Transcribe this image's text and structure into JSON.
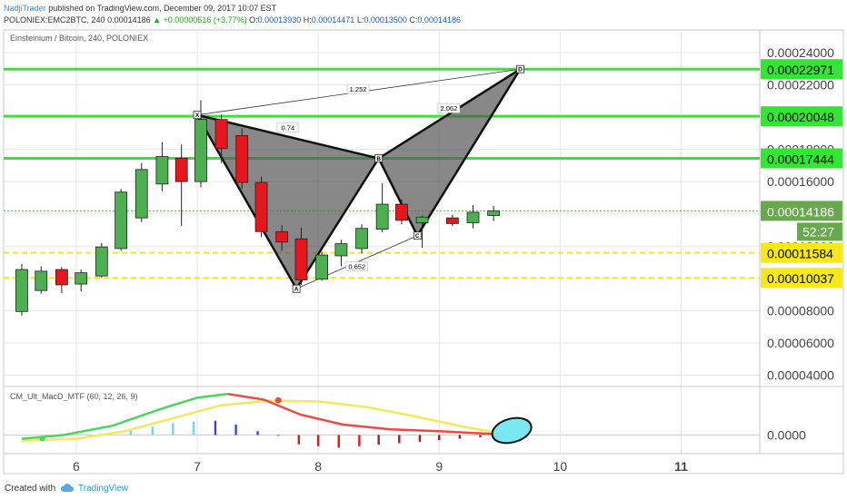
{
  "header": {
    "author": "NadjiTrader",
    "published_text": " published on TradingView.com, December 09, 2017 10:07 EST",
    "symbol_line_prefix": "POLONIEX:EMC2BTC, 240",
    "price": "0.00014186",
    "change": "▲ +0.00000516 (+3.77%)",
    "o_label": "O:",
    "o_value": "0.00013930",
    "h_label": "H:",
    "h_value": "0.00014471",
    "l_label": "L:",
    "l_value": "0.00013500",
    "c_label": "C:",
    "c_value": "0.00014186"
  },
  "chart_data": {
    "type": "candlestick",
    "title": "Einsteinium / Bitcoin, 240, POLONIEX",
    "x_ticks": [
      "6",
      "7",
      "8",
      "9",
      "10",
      "11"
    ],
    "x_tick_days": [
      6,
      7,
      8,
      9,
      10,
      11
    ],
    "x_range": [
      5.4,
      11.65
    ],
    "ylim": [
      3.3e-05,
      0.000254
    ],
    "y_ticks": [
      "0.00004000",
      "0.00006000",
      "0.00008000",
      "0.00010000",
      "0.00012000",
      "0.00014000",
      "0.00016000",
      "0.00018000",
      "0.00020000",
      "0.00022000",
      "0.00024000"
    ],
    "y_tick_values": [
      4e-05,
      6e-05,
      8e-05,
      0.0001,
      0.00012,
      0.00014,
      0.00016,
      0.00018,
      0.0002,
      0.00022,
      0.00024
    ],
    "candles": [
      {
        "day": 5.55,
        "open": 7.95e-05,
        "close": 0.0001055,
        "high": 0.000109,
        "low": 7.7e-05
      },
      {
        "day": 5.71,
        "open": 9.25e-05,
        "close": 0.0001045,
        "high": 0.0001075,
        "low": 9.05e-05
      },
      {
        "day": 5.88,
        "open": 0.0001055,
        "close": 9.6e-05,
        "high": 0.000107,
        "low": 9.1e-05
      },
      {
        "day": 6.04,
        "open": 9.65e-05,
        "close": 0.0001035,
        "high": 0.0001055,
        "low": 9.2e-05
      },
      {
        "day": 6.21,
        "open": 0.0001015,
        "close": 0.0001195,
        "high": 0.000122,
        "low": 0.0001005
      },
      {
        "day": 6.37,
        "open": 0.0001185,
        "close": 0.0001535,
        "high": 0.0001555,
        "low": 0.000117
      },
      {
        "day": 6.54,
        "open": 0.0001375,
        "close": 0.0001675,
        "high": 0.0001715,
        "low": 0.000135
      },
      {
        "day": 6.71,
        "open": 0.0001585,
        "close": 0.0001755,
        "high": 0.0001845,
        "low": 0.000154
      },
      {
        "day": 6.87,
        "open": 0.0001745,
        "close": 0.00016,
        "high": 0.000183,
        "low": 0.0001325
      },
      {
        "day": 7.03,
        "open": 0.00016,
        "close": 0.0001985,
        "high": 0.0002105,
        "low": 0.0001565
      },
      {
        "day": 7.2,
        "open": 0.0001985,
        "close": 0.0001805,
        "high": 0.0002015,
        "low": 0.0001715
      },
      {
        "day": 7.37,
        "open": 0.0001885,
        "close": 0.0001595,
        "high": 0.000193,
        "low": 0.0001555
      },
      {
        "day": 7.53,
        "open": 0.0001595,
        "close": 0.000129,
        "high": 0.000163,
        "low": 0.0001255
      },
      {
        "day": 7.7,
        "open": 0.000129,
        "close": 0.0001225,
        "high": 0.000133,
        "low": 0.000117
      },
      {
        "day": 7.86,
        "open": 0.0001245,
        "close": 9.9e-05,
        "high": 0.0001315,
        "low": 9.6e-05
      },
      {
        "day": 8.03,
        "open": 9.95e-05,
        "close": 0.0001145,
        "high": 0.0001165,
        "low": 9.85e-05
      },
      {
        "day": 8.19,
        "open": 0.000114,
        "close": 0.0001215,
        "high": 0.000124,
        "low": 0.0001075
      },
      {
        "day": 8.36,
        "open": 0.0001185,
        "close": 0.000131,
        "high": 0.0001335,
        "low": 0.0001155
      },
      {
        "day": 8.53,
        "open": 0.0001305,
        "close": 0.000146,
        "high": 0.000159,
        "low": 0.0001285
      },
      {
        "day": 8.69,
        "open": 0.000146,
        "close": 0.000136,
        "high": 0.000149,
        "low": 0.0001335
      },
      {
        "day": 8.86,
        "open": 0.0001345,
        "close": 0.000138,
        "high": 0.000139,
        "low": 0.000119
      },
      {
        "day": 9.11,
        "open": 0.0001375,
        "close": 0.000134,
        "high": 0.0001395,
        "low": 0.0001325
      },
      {
        "day": 9.28,
        "open": 0.0001345,
        "close": 0.000141,
        "high": 0.0001455,
        "low": 0.000131
      },
      {
        "day": 9.45,
        "open": 0.000139,
        "close": 0.0001419,
        "high": 0.000145,
        "low": 0.0001355
      }
    ],
    "harmonic_points": [
      {
        "label": "X",
        "day": 7.0,
        "value": 0.0002013
      },
      {
        "label": "A",
        "day": 7.82,
        "value": 9.36e-05
      },
      {
        "label": "B",
        "day": 8.5,
        "value": 0.0001744
      },
      {
        "label": "C",
        "day": 8.82,
        "value": 0.0001265
      },
      {
        "label": "D",
        "day": 9.67,
        "value": 0.0002297
      }
    ],
    "ratios": [
      {
        "label": "0.74",
        "day": 7.75,
        "value": 0.0001935
      },
      {
        "label": "1.252",
        "day": 8.33,
        "value": 0.0002174
      },
      {
        "label": "2.062",
        "day": 9.08,
        "value": 0.0002055
      },
      {
        "label": "0.652",
        "day": 8.32,
        "value": 0.0001075
      }
    ],
    "levels": [
      {
        "value": 0.00022971,
        "label": "0.00022971",
        "color": "#33e633",
        "style": "solid"
      },
      {
        "value": 0.00020048,
        "label": "0.00020048",
        "color": "#33e633",
        "style": "solid"
      },
      {
        "value": 0.00017444,
        "label": "0.00017444",
        "color": "#33e633",
        "style": "solid"
      },
      {
        "value": 0.00011584,
        "label": "0.00011584",
        "color": "#f7e81a",
        "style": "dashed"
      },
      {
        "value": 0.00010037,
        "label": "0.00010037",
        "color": "#f7e81a",
        "style": "dashed"
      }
    ],
    "last_price": {
      "value": 0.00014186,
      "label": "0.00014186"
    },
    "countdown": "52:27",
    "colors": {
      "up": "#4caf50",
      "down": "#e8161c",
      "level_green": "#33e633",
      "level_yellow": "#f7e81a",
      "price_tag": "#6aa84f"
    }
  },
  "indicator": {
    "title": "CM_Ult_MacD_MTF (60, 12, 26, 9)",
    "zero_label": "0.0000",
    "macd_line": [
      [
        5.55,
        -0.1
      ],
      [
        5.9,
        0.0
      ],
      [
        6.3,
        0.25
      ],
      [
        6.7,
        0.7
      ],
      [
        7.0,
        1.0
      ],
      [
        7.25,
        1.1
      ],
      [
        7.55,
        0.95
      ],
      [
        7.85,
        0.55
      ],
      [
        8.2,
        0.28
      ],
      [
        8.6,
        0.15
      ],
      [
        9.0,
        0.1
      ],
      [
        9.3,
        0.05
      ],
      [
        9.45,
        0.03
      ]
    ],
    "signal_line": [
      [
        5.55,
        -0.15
      ],
      [
        6.0,
        -0.1
      ],
      [
        6.4,
        0.1
      ],
      [
        6.8,
        0.45
      ],
      [
        7.2,
        0.8
      ],
      [
        7.6,
        0.92
      ],
      [
        8.0,
        0.9
      ],
      [
        8.4,
        0.75
      ],
      [
        8.8,
        0.5
      ],
      [
        9.2,
        0.22
      ],
      [
        9.45,
        0.08
      ]
    ],
    "histogram": [
      [
        6.1,
        0.02
      ],
      [
        6.28,
        0.06
      ],
      [
        6.45,
        0.15
      ],
      [
        6.63,
        0.22
      ],
      [
        6.8,
        0.32
      ],
      [
        6.97,
        0.36
      ],
      [
        7.15,
        0.38
      ],
      [
        7.32,
        0.28
      ],
      [
        7.5,
        0.1
      ],
      [
        7.67,
        -0.02
      ],
      [
        7.84,
        -0.25
      ],
      [
        8.0,
        -0.3
      ],
      [
        8.17,
        -0.34
      ],
      [
        8.34,
        -0.3
      ],
      [
        8.5,
        -0.26
      ],
      [
        8.67,
        -0.22
      ],
      [
        8.84,
        -0.18
      ],
      [
        9.0,
        -0.14
      ],
      [
        9.17,
        -0.1
      ],
      [
        9.34,
        -0.06
      ],
      [
        9.5,
        -0.03
      ]
    ],
    "ylim": [
      -0.5,
      1.3
    ]
  },
  "footer": {
    "created": "Created with",
    "brand": "TradingView"
  }
}
